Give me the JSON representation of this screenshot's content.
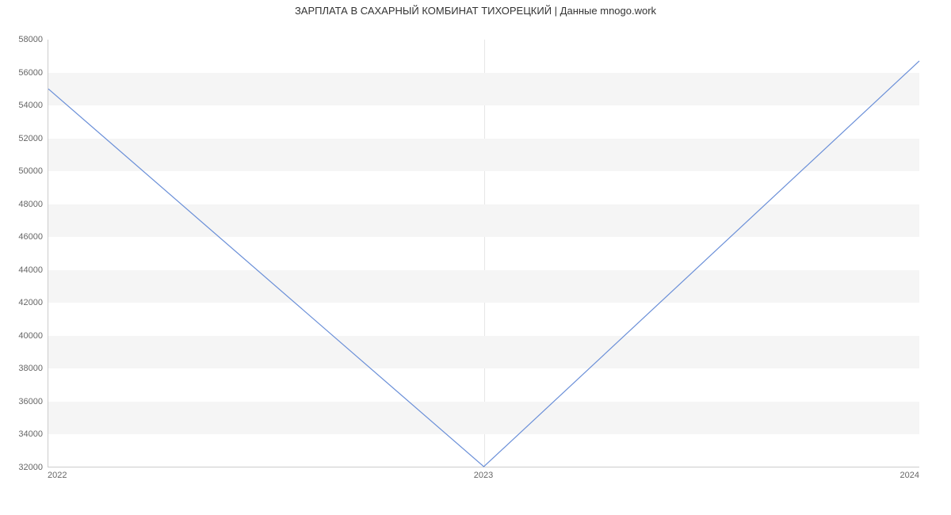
{
  "chart_data": {
    "type": "line",
    "title": "ЗАРПЛАТА В  САХАРНЫЙ КОМБИНАТ ТИХОРЕЦКИЙ | Данные mnogo.work",
    "xlabel": "",
    "ylabel": "",
    "x": [
      2022,
      2023,
      2024
    ],
    "values": [
      55000,
      32000,
      56700
    ],
    "x_ticks": [
      2022,
      2023,
      2024
    ],
    "y_ticks": [
      32000,
      34000,
      36000,
      38000,
      40000,
      42000,
      44000,
      46000,
      48000,
      50000,
      52000,
      54000,
      56000,
      58000
    ],
    "xlim": [
      2022,
      2024
    ],
    "ylim": [
      32000,
      58000
    ],
    "grid": true,
    "legend": false,
    "colors": {
      "line": "#6a8fd8",
      "band": "#f5f5f5",
      "axis": "#cccccc",
      "text": "#666666"
    }
  }
}
